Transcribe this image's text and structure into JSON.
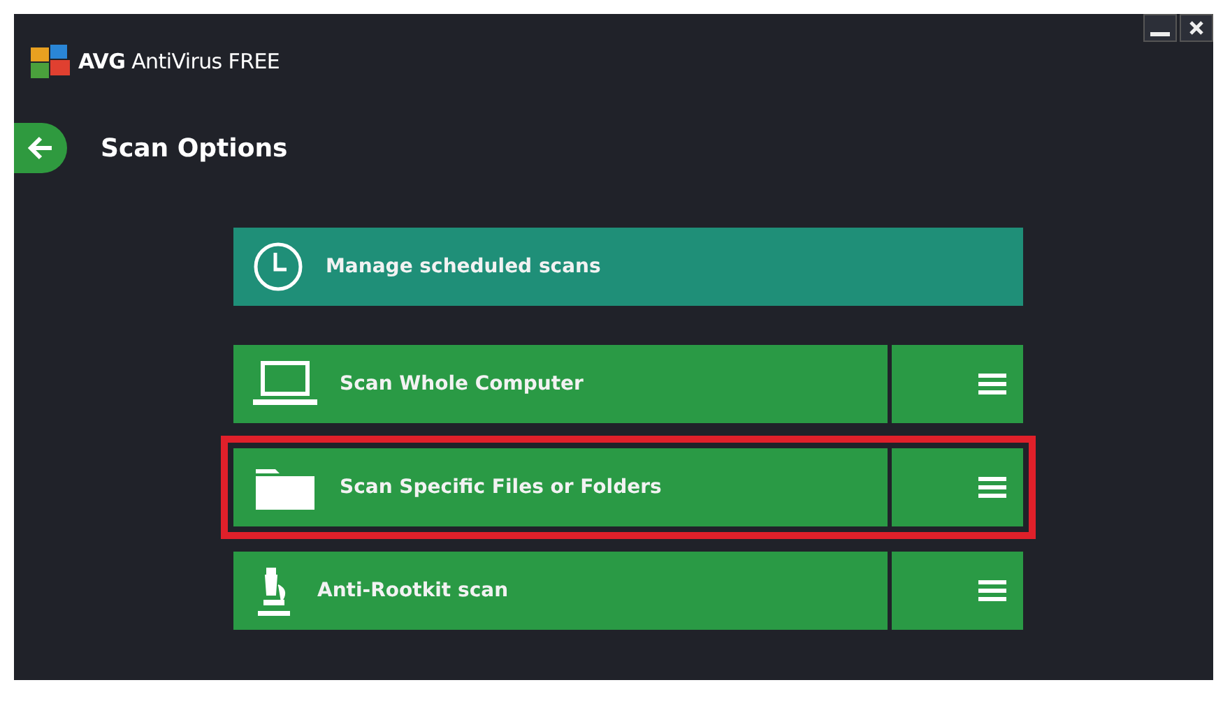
{
  "window": {
    "title": "**AVG** AntiVirus FREE"
  },
  "page": {
    "title": "Scan Options"
  },
  "scan_options": [
    {
      "kind": "schedule",
      "label": "Manage scheduled scans",
      "highlighted": false
    },
    {
      "kind": "computer",
      "label": "Scan Whole Computer",
      "highlighted": false
    },
    {
      "kind": "folder",
      "label": "Scan Specific Files or Folders",
      "highlighted": true
    },
    {
      "kind": "rootkit",
      "label": "Anti-Rootkit scan",
      "highlighted": false
    }
  ]
}
